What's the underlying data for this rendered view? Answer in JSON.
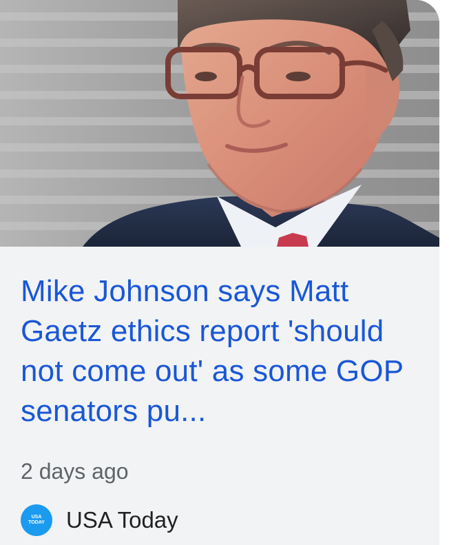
{
  "article": {
    "image_alt": "Mike Johnson portrait",
    "headline": "Mike Johnson says Matt Gaetz ethics report 'should not come out' as some GOP senators pu...",
    "timestamp": "2 days ago",
    "source": {
      "name": "USA Today",
      "logo_icon": "usa-today-logo-icon",
      "logo_color": "#1b9bf0"
    }
  },
  "colors": {
    "headline": "#1a57d6",
    "card_background": "#f1f3f4",
    "meta_text": "#5f6368",
    "source_text": "#202124"
  }
}
